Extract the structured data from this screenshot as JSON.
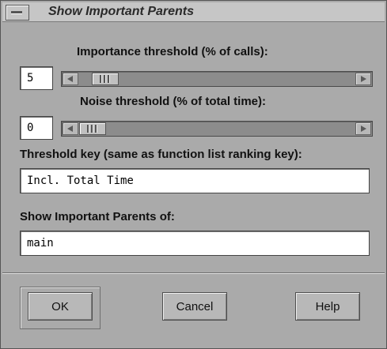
{
  "window": {
    "title": "Show Important Parents"
  },
  "importance": {
    "label": "Importance threshold (% of calls):",
    "value": "5",
    "slider_fraction": 0.05
  },
  "noise": {
    "label": "Noise threshold (% of total time):",
    "value": "0",
    "slider_fraction": 0.0
  },
  "threshold_key": {
    "label": "Threshold key (same as function list ranking key):",
    "value": "Incl. Total Time"
  },
  "show_parents": {
    "label": "Show Important Parents of:",
    "value": "main"
  },
  "buttons": {
    "ok": "OK",
    "cancel": "Cancel",
    "help": "Help"
  },
  "icons": {
    "window_menu": "window-menu-icon",
    "scroll_left": "arrow-left-icon",
    "scroll_right": "arrow-right-icon"
  }
}
